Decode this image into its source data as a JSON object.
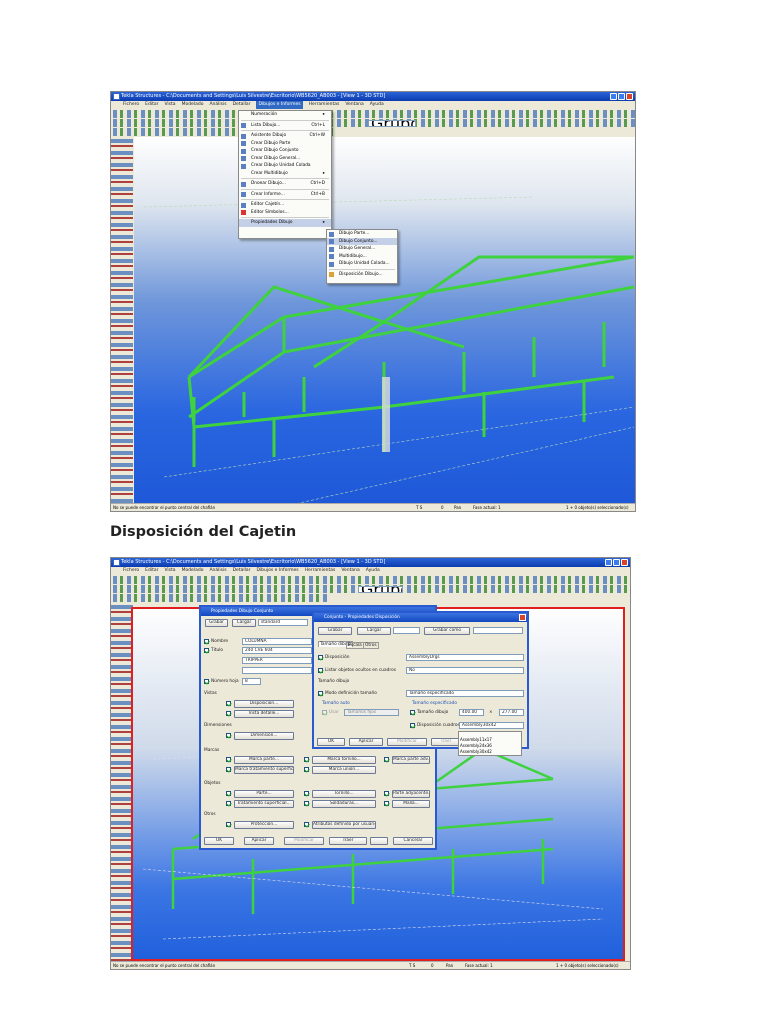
{
  "screenshot1": {
    "title": "Tekla Structures - C:\\Documents and Settings\\Luis Silvestre\\Escritorio\\WB5620_AB003 - [View 1 - 3D STD]",
    "menu": [
      "Fichero",
      "Editar",
      "Vista",
      "Modelado",
      "Análisis",
      "Detallar",
      "Dibujos e Informes",
      "Herramientas",
      "Ventana",
      "Ayuda"
    ],
    "toolbar_combo": "Grupo Por Defecto",
    "dropdown": [
      {
        "label": "Numeración",
        "shortcut": "▸"
      },
      {
        "label": "Lista Dibujo...",
        "shortcut": "Ctrl+L"
      },
      {
        "label": "Asistente Dibujo",
        "shortcut": "Ctrl+W"
      },
      {
        "label": "Crear Dibujo Parte",
        "shortcut": ""
      },
      {
        "label": "Crear Dibujo Conjunto",
        "shortcut": ""
      },
      {
        "label": "Crear Dibujo General...",
        "shortcut": ""
      },
      {
        "label": "Crear Dibujo Unidad Colada",
        "shortcut": ""
      },
      {
        "label": "Crear Multidibujo",
        "shortcut": "▸"
      },
      {
        "label": "Dnoear Dibujo...",
        "shortcut": "Ctrl+D"
      },
      {
        "label": "Crear Informe...",
        "shortcut": "Ctrl+B"
      },
      {
        "label": "Editor Cajetín...",
        "shortcut": ""
      },
      {
        "label": "Editor Símbolos...",
        "shortcut": ""
      },
      {
        "label": "Propiedades Dibujo",
        "shortcut": "▸"
      }
    ],
    "submenu": [
      "Dibujo Parte...",
      "Dibujo Conjunto...",
      "Dibujo General...",
      "Multidibujo...",
      "Dibujo Unidad Colada...",
      "Disposición Dibujo..."
    ],
    "status": {
      "message": "No se puede encontrar el punto central del chaflán",
      "snap": "T S",
      "count": "0",
      "mode": "Pan",
      "phase": "Fase actual: 1",
      "selection": "1 + 0 objeto(s) seleccionado(s)"
    }
  },
  "heading": "Disposición del Cajetin",
  "screenshot2": {
    "dialog1": {
      "title": "Propiedades Dibujo Conjunto",
      "save": "Grabar",
      "load": "Cargar",
      "load_value": "standard",
      "name_label": "Nombre",
      "name_value": "COLUMNA",
      "title_label": "Título",
      "title_values": [
        "240 CVE 604",
        "TRIPPER",
        ""
      ],
      "sheet_label": "Número hoja",
      "sheet_value": "8",
      "sections": [
        "Vistas",
        "Dimensiones",
        "Marcas",
        "Objetos",
        "Otros"
      ],
      "buttons": [
        "Disposición...",
        "Vista detalle...",
        "Dimensión...",
        "Marca parte...",
        "Marca tornillo...",
        "Marca parte adv...",
        "Marca tratamiento superficial...",
        "Marca unión...",
        "Parte...",
        "Tornillo...",
        "Parte adyacente...",
        "Tratamiento superficial...",
        "Soldaduras...",
        "Malla...",
        "Protección...",
        "Atributos definido por usuario..."
      ],
      "footer": [
        "OK",
        "Aplicar",
        "Modificar",
        "Traer",
        "Cancelar"
      ]
    },
    "dialog2": {
      "title": "Conjunto - Propiedades Disposición",
      "save": "Grabar",
      "load": "Cargar",
      "save_as": "Grabar como",
      "tabs": [
        "Tamaño dibujo",
        "Escala",
        "Otros"
      ],
      "layout_label": "Disposición",
      "layout_value": "AssemblyDrgs",
      "list_label": "Listar objetos ocultos en cuadros",
      "list_value": "No",
      "size_section": "Tamaño dibujo",
      "mode_label": "Modo definición tamaño",
      "mode_value": "Tamaño especificado",
      "auto_section": "Tamaño auto",
      "use_label": "Usar",
      "fixed_value": "Tamaños fijos",
      "spec_section": "Tamaño especificado",
      "draw_size_label": "Tamaño dibujo",
      "width": "400.00",
      "x": "×",
      "height": "277.00",
      "table_layout_label": "Disposición cuadros",
      "table_layout_value": "Assembly30x42",
      "options": [
        "",
        "Assembly11x17",
        "Assembly24x36",
        "Assembly30x42"
      ],
      "footer": [
        "OK",
        "Aplicar",
        "Modificar",
        "Traer"
      ]
    },
    "status": {
      "message": "No se puede encontrar el punto central del chaflán",
      "snap": "T S",
      "count": "0",
      "mode": "Pan",
      "phase": "Fase actual: 1",
      "selection": "1 + 0 objeto(s) seleccionado(s)"
    }
  }
}
